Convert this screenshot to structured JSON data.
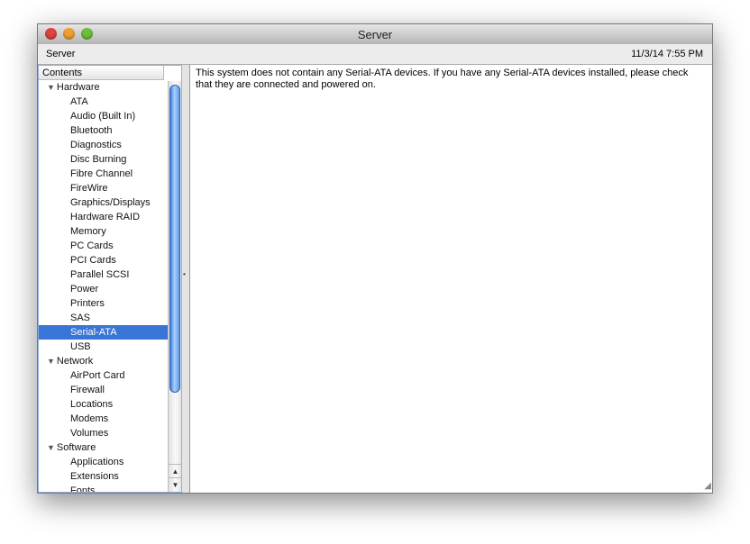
{
  "window": {
    "title": "Server",
    "close_color": "#e0443e",
    "minimize_color": "#f0a030",
    "zoom_color": "#6cc03c"
  },
  "bar": {
    "left": "Server",
    "right": "11/3/14 7:55 PM"
  },
  "sidebar": {
    "header": "Contents",
    "groups": [
      {
        "label": "Hardware",
        "items": [
          "ATA",
          "Audio (Built In)",
          "Bluetooth",
          "Diagnostics",
          "Disc Burning",
          "Fibre Channel",
          "FireWire",
          "Graphics/Displays",
          "Hardware RAID",
          "Memory",
          "PC Cards",
          "PCI Cards",
          "Parallel SCSI",
          "Power",
          "Printers",
          "SAS",
          "Serial-ATA",
          "USB"
        ]
      },
      {
        "label": "Network",
        "items": [
          "AirPort Card",
          "Firewall",
          "Locations",
          "Modems",
          "Volumes"
        ]
      },
      {
        "label": "Software",
        "items": [
          "Applications",
          "Extensions",
          "Fonts"
        ]
      }
    ],
    "selected": "Serial-ATA"
  },
  "content": {
    "message": "This system does not contain any Serial-ATA devices. If you have any Serial-ATA devices installed, please check that they are connected and powered on."
  }
}
